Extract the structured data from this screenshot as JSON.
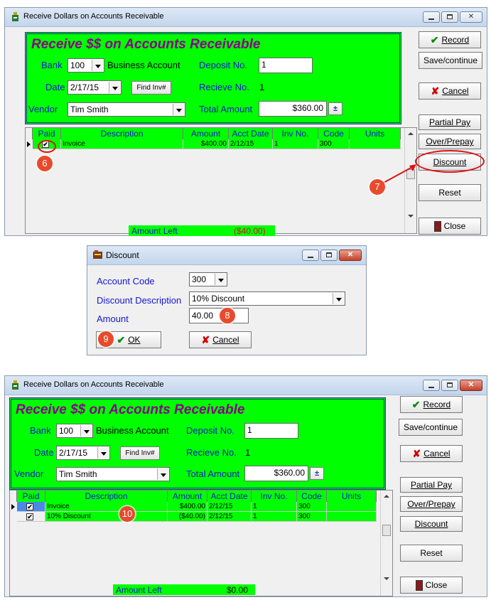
{
  "window_top": {
    "title": "Receive Dollars on Accounts Receivable",
    "panel_title": "Receive $$ on Accounts Receivable",
    "bank_label": "Bank",
    "bank_value": "100",
    "bank_name": "Business Account",
    "deposit_label": "Deposit No.",
    "deposit_value": "1",
    "date_label": "Date",
    "date_value": "2/17/15",
    "find_inv_label": "Find Inv#",
    "receive_label": "Recieve No.",
    "receive_value": "1",
    "vendor_label": "Vendor",
    "vendor_value": "Tim Smith",
    "total_label": "Total Amount",
    "total_value": "$360.00",
    "buttons": {
      "record": "Record",
      "save_continue": "Save/continue",
      "cancel": "Cancel",
      "partial_pay": "Partial Pay",
      "over_prepay": "Over/Prepay",
      "discount": "Discount",
      "reset": "Reset",
      "close": "Close"
    },
    "columns": [
      "Paid",
      "Description",
      "Amount",
      "Acct Date",
      "Inv No.",
      "Code",
      "Units"
    ],
    "rows": [
      {
        "paid": "✔",
        "description": "Invoice",
        "amount": "$400.00",
        "acct_date": "2/12/15",
        "inv_no": "1",
        "code": "300",
        "units": ""
      }
    ],
    "amount_left_label": "Amount Left",
    "amount_left_value": "($40.00)",
    "badges": {
      "b6": "6",
      "b7": "7"
    }
  },
  "dialog": {
    "title": "Discount",
    "account_code_label": "Account Code",
    "account_code_value": "300",
    "desc_label": "Discount Description",
    "desc_value": "10% Discount",
    "amount_label": "Amount",
    "amount_value": "40.00",
    "ok_label": "OK",
    "cancel_label": "Cancel",
    "badges": {
      "b8": "8",
      "b9": "9"
    }
  },
  "window_bottom": {
    "title": "Receive Dollars on Accounts Receivable",
    "panel_title": "Receive $$ on Accounts Receivable",
    "bank_label": "Bank",
    "bank_value": "100",
    "bank_name": "Business Account",
    "deposit_label": "Deposit No.",
    "deposit_value": "1",
    "date_label": "Date",
    "date_value": "2/17/15",
    "find_inv_label": "Find Inv#",
    "receive_label": "Recieve No.",
    "receive_value": "1",
    "vendor_label": "Vendor",
    "vendor_value": "Tim Smith",
    "total_label": "Total Amount",
    "total_value": "$360.00",
    "buttons": {
      "record": "Record",
      "save_continue": "Save/continue",
      "cancel": "Cancel",
      "partial_pay": "Partial Pay",
      "over_prepay": "Over/Prepay",
      "discount": "Discount",
      "reset": "Reset",
      "close": "Close"
    },
    "columns": [
      "Paid",
      "Description",
      "Amount",
      "Acct Date",
      "Inv No.",
      "Code",
      "Units"
    ],
    "rows": [
      {
        "paid": "✔",
        "description": "Invoice",
        "amount": "$400.00",
        "acct_date": "2/12/15",
        "inv_no": "1",
        "code": "300",
        "units": ""
      },
      {
        "paid": "✔",
        "description": "10% Discount",
        "amount": "($40.00)",
        "acct_date": "2/12/15",
        "inv_no": "1",
        "code": "300",
        "units": ""
      }
    ],
    "amount_left_label": "Amount Left",
    "amount_left_value": "$0.00",
    "badges": {
      "b10": "10"
    }
  },
  "colors": {
    "panel_green": "#00ff00",
    "label_blue": "#1515d0",
    "title_purple": "#8b008b",
    "badge": "#e84a2c",
    "negative": "#c02020"
  }
}
